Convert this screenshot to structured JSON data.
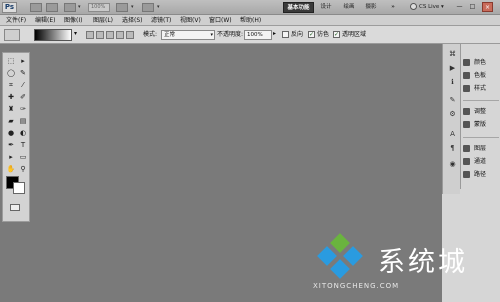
{
  "titlebar": {
    "logo": "Ps",
    "zoom": "100%",
    "workspaces": [
      "基本功能",
      "设计",
      "绘画",
      "摄影"
    ],
    "more": "»",
    "cs_live": "CS Live",
    "min": "—",
    "max": "□",
    "close": "×"
  },
  "menu": [
    "文件(F)",
    "编辑(E)",
    "图像(I)",
    "图层(L)",
    "选择(S)",
    "滤镜(T)",
    "视图(V)",
    "窗口(W)",
    "帮助(H)"
  ],
  "options": {
    "mode_label": "模式:",
    "mode_value": "正常",
    "opacity_label": "不透明度:",
    "opacity_value": "100%",
    "reverse_label": "反向",
    "dither_label": "仿色",
    "transparency_label": "透明区域"
  },
  "panels": [
    {
      "icon": "color-icon",
      "label": "颜色"
    },
    {
      "icon": "swatches-icon",
      "label": "色板"
    },
    {
      "icon": "styles-icon",
      "label": "样式"
    },
    {
      "icon": "adjustments-icon",
      "label": "调整"
    },
    {
      "icon": "masks-icon",
      "label": "蒙版"
    },
    {
      "icon": "layers-icon",
      "label": "图层"
    },
    {
      "icon": "channels-icon",
      "label": "通道"
    },
    {
      "icon": "paths-icon",
      "label": "路径"
    }
  ],
  "watermark": {
    "title": "系统城",
    "subtitle": "XITONGCHENG.COM",
    "colors": {
      "top": "#6ab43e",
      "left": "#2a9be0",
      "right": "#2a9be0",
      "bottom": "#2a9be0"
    }
  },
  "colors": {
    "canvas": "#7a7a7a",
    "active_workspace": "#3a3a3a",
    "foreground": "#000000",
    "background": "#ffffff"
  }
}
